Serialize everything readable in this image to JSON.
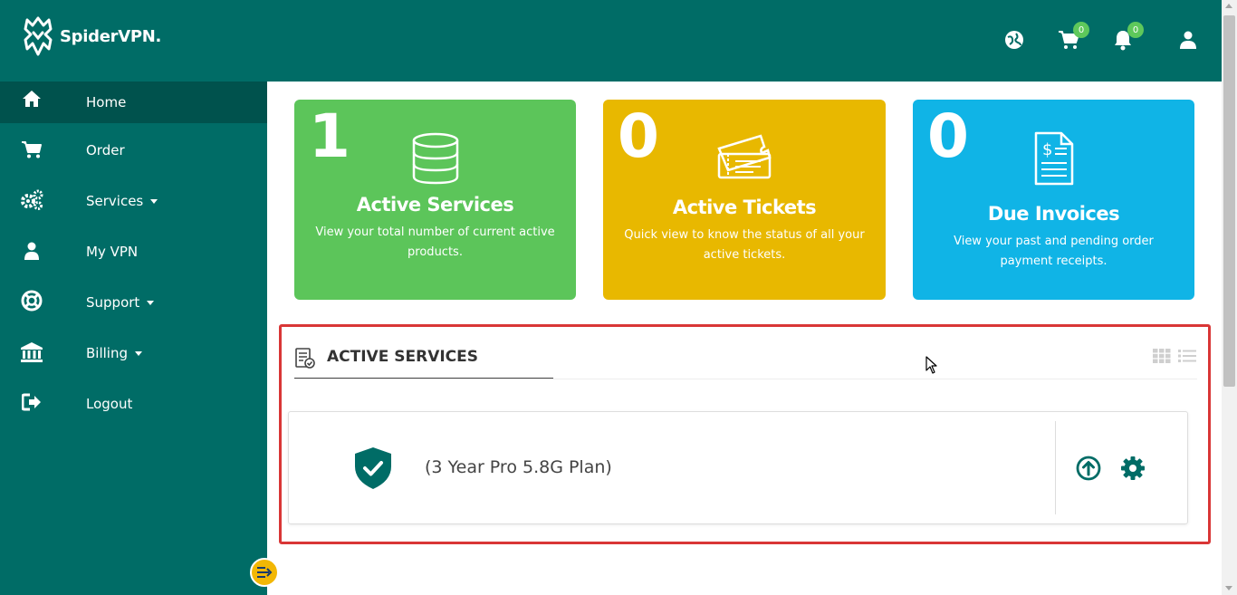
{
  "brand": {
    "name": "SpiderVPN."
  },
  "header": {
    "cart_count": "0",
    "notification_count": "0"
  },
  "sidebar": {
    "items": [
      {
        "label": "Home",
        "icon": "home-icon",
        "active": true
      },
      {
        "label": "Order",
        "icon": "cart-icon"
      },
      {
        "label": "Services",
        "icon": "cogs-icon",
        "dropdown": true
      },
      {
        "label": "My VPN",
        "icon": "user-icon"
      },
      {
        "label": "Support",
        "icon": "lifebuoy-icon",
        "dropdown": true
      },
      {
        "label": "Billing",
        "icon": "bank-icon",
        "dropdown": true
      },
      {
        "label": "Logout",
        "icon": "logout-icon"
      }
    ]
  },
  "cards": [
    {
      "count": "1",
      "title": "Active Services",
      "desc": "View your total number of current active products.",
      "color": "#5cc55a",
      "icon": "database-icon"
    },
    {
      "count": "0",
      "title": "Active Tickets",
      "desc": "Quick view to know the  status of all your active tickets.",
      "color": "#e8b800",
      "icon": "tickets-icon"
    },
    {
      "count": "0",
      "title": "Due Invoices",
      "desc": "View your past and pending order payment receipts.",
      "color": "#10b4e6",
      "icon": "invoice-icon"
    }
  ],
  "active_services": {
    "title": "ACTIVE SERVICES",
    "items": [
      {
        "name": "(3 Year Pro 5.8G Plan)"
      }
    ]
  },
  "colors": {
    "primary": "#006c66",
    "primary_dark": "#00524d",
    "highlight_border": "#d93636",
    "collapse_button": "#f2b705"
  }
}
